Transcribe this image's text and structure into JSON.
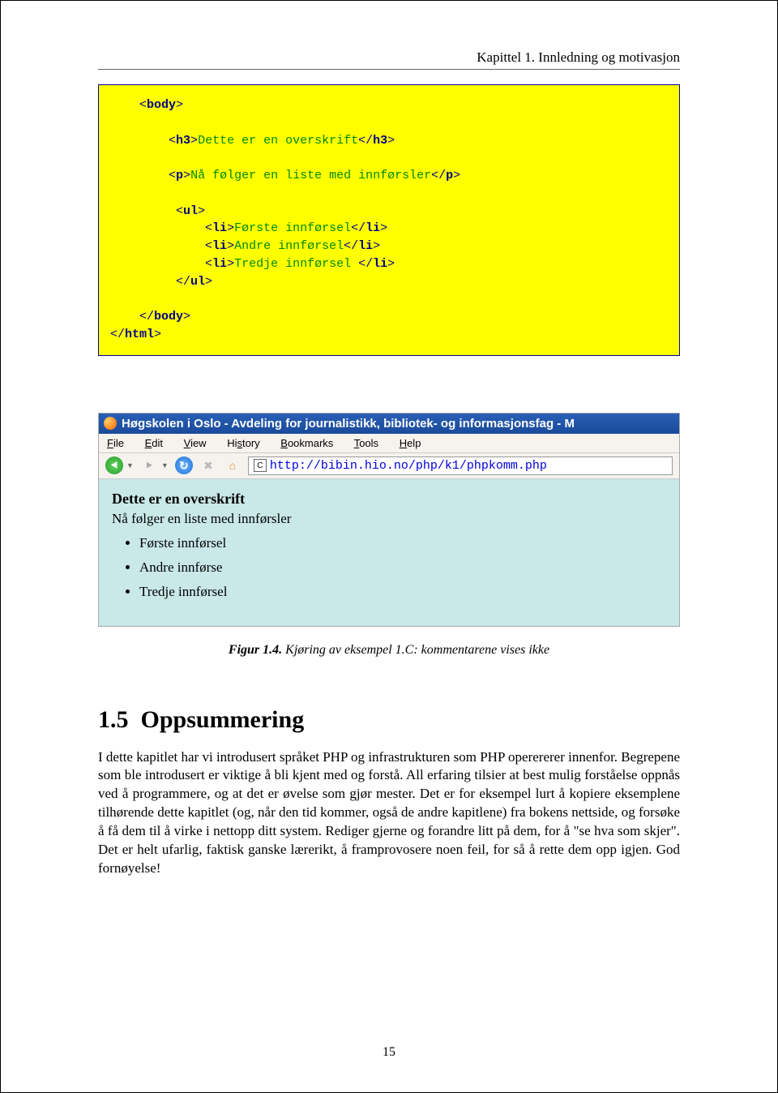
{
  "header": "Kapittel 1. Innledning og motivasjon",
  "code": {
    "l1a": "body",
    "l2a": "h3",
    "l2t": "Dette er en overskrift",
    "l2b": "h3",
    "l3a": "p",
    "l3t": "Nå følger en liste med innførsler",
    "l3b": "p",
    "l4a": "ul",
    "l5a": "li",
    "l5t": "Første innførsel",
    "l5b": "li",
    "l6a": "li",
    "l6t": "Andre innførsel",
    "l6b": "li",
    "l7a": "li",
    "l7t": "Tredje innførsel ",
    "l7b": "li",
    "l8a": "ul",
    "l9a": "body",
    "l10a": "html"
  },
  "browser": {
    "title": "Høgskolen i Oslo - Avdeling for journalistikk, bibliotek- og informasjonsfag - M",
    "menu": {
      "file": "File",
      "edit": "Edit",
      "view": "View",
      "history": "History",
      "bookmarks": "Bookmarks",
      "tools": "Tools",
      "help": "Help"
    },
    "url": "http://bibin.hio.no/php/k1/phpkomm.php",
    "content": {
      "h": "Dette er en overskrift",
      "p": "Nå følger en liste med innførsler",
      "li1": "Første innførsel",
      "li2": "Andre innførse",
      "li3": "Tredje innførsel"
    }
  },
  "caption": {
    "bold": "Figur 1.4.",
    "ital": " Kjøring av eksempel 1.C: kommentarene vises ikke"
  },
  "section": {
    "num": "1.5",
    "title": "Oppsummering"
  },
  "para": "I dette kapitlet har vi introdusert språket PHP og infrastrukturen som PHP operererer innenfor. Begrepene som ble introdusert er viktige å bli kjent med og forstå. All erfaring tilsier at best mulig forståelse oppnås ved å programmere, og at det er øvelse som gjør mester. Det er for eksempel lurt å kopiere eksemplene tilhørende dette kapitlet (og, når den tid kommer, også de andre kapitlene) fra bokens nettside, og forsøke å få dem til å virke i nettopp ditt system. Rediger gjerne og forandre litt på dem, for å \"se hva som skjer\". Det er helt ufarlig, faktisk ganske lærerikt, å framprovosere noen feil, for så å rette dem opp igjen. God fornøyelse!",
  "pagenum": "15"
}
